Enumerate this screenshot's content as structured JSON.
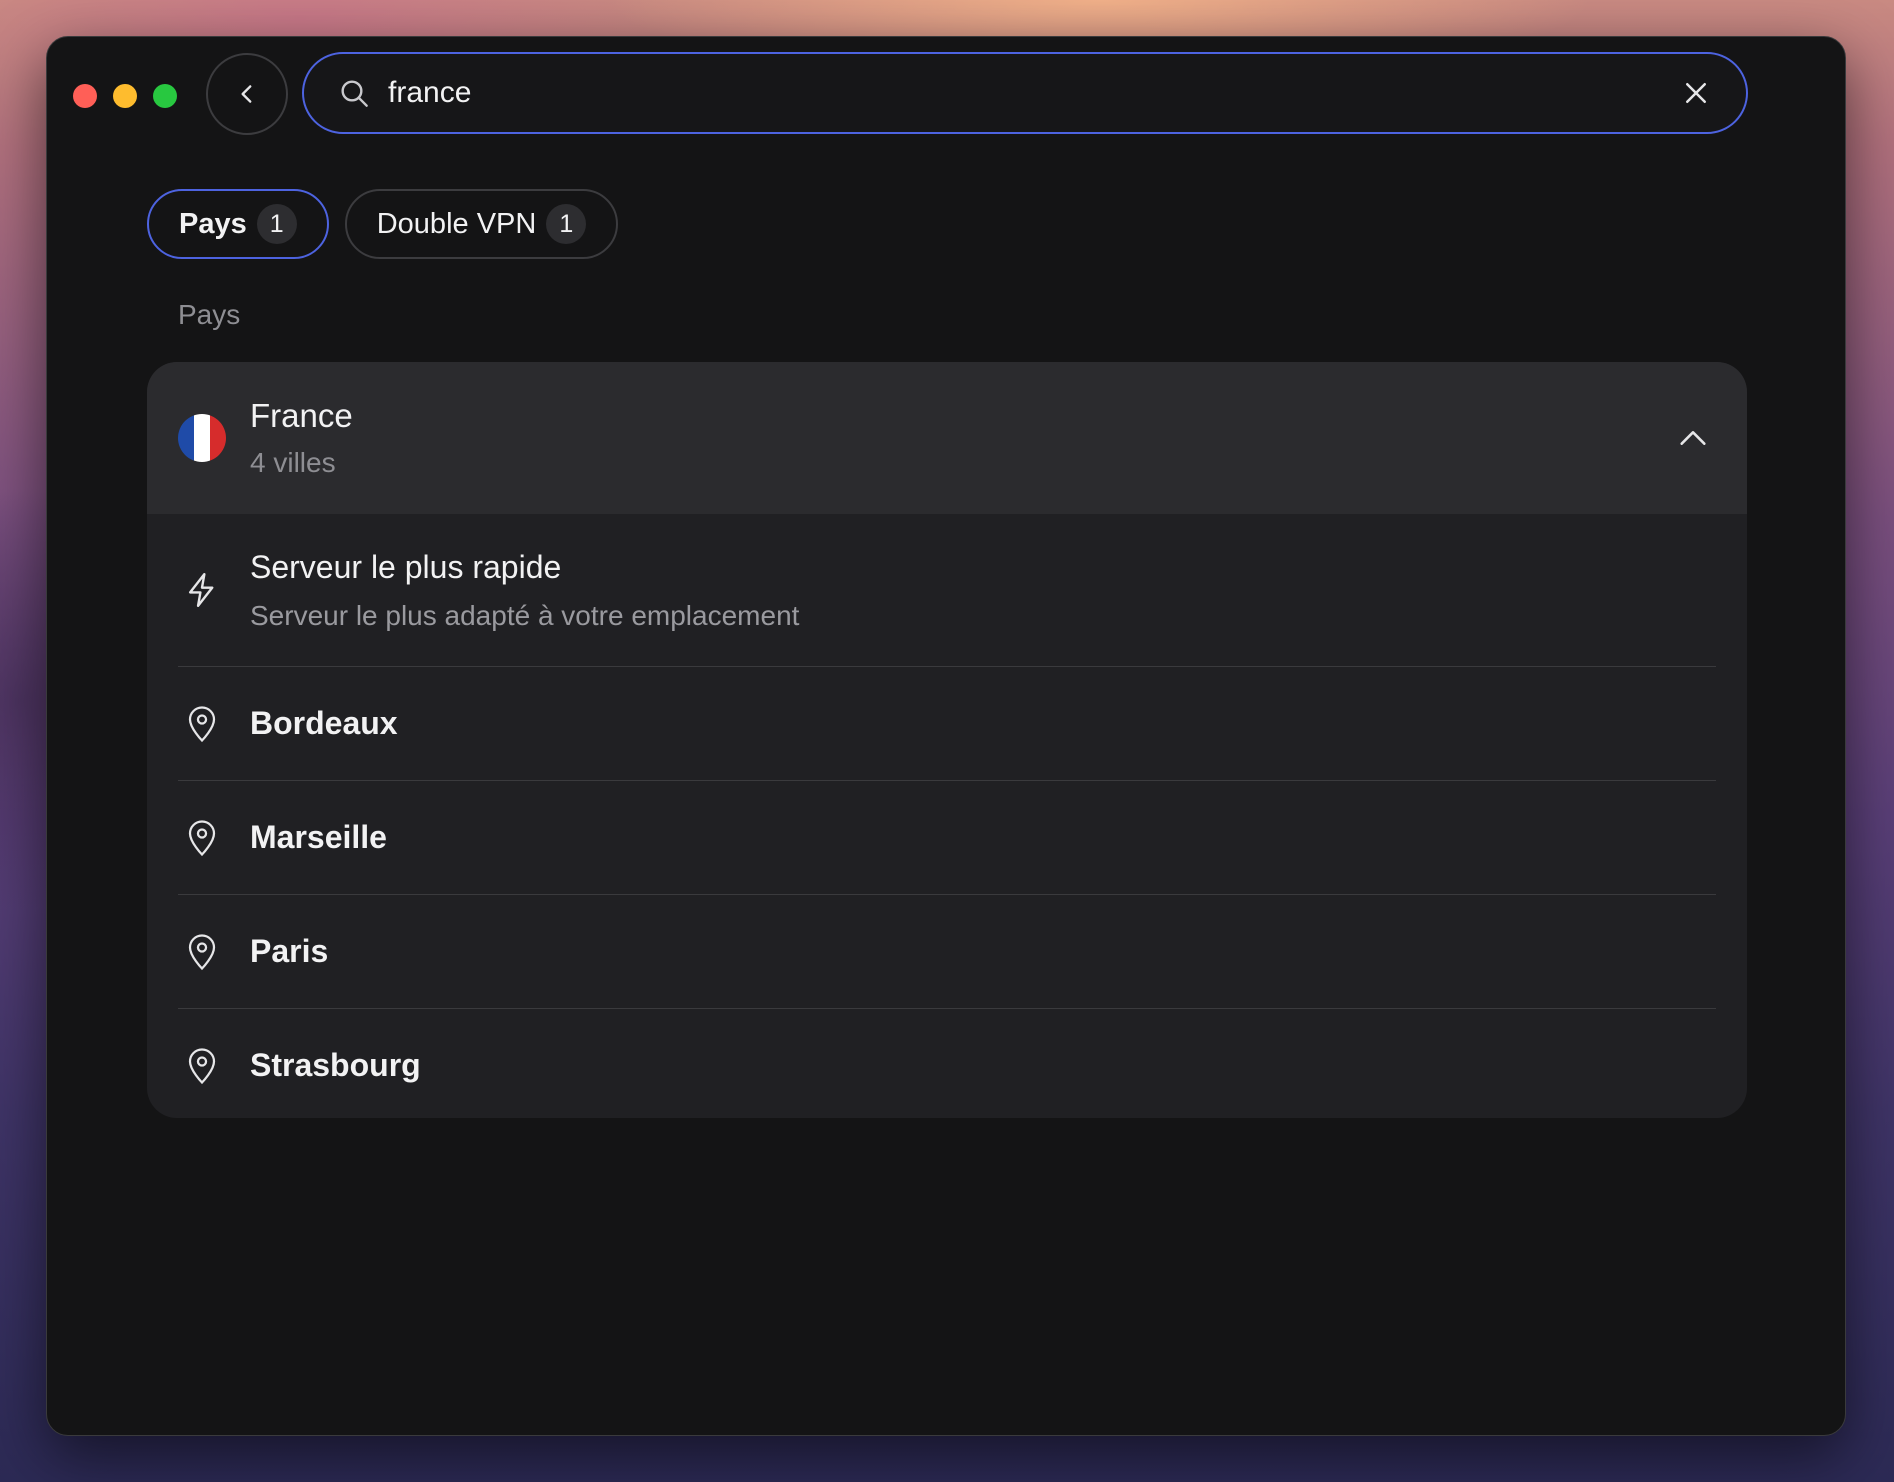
{
  "search": {
    "value": "france"
  },
  "filters": [
    {
      "label": "Pays",
      "count": "1",
      "active": true
    },
    {
      "label": "Double VPN",
      "count": "1",
      "active": false
    }
  ],
  "section": {
    "label": "Pays"
  },
  "country": {
    "name": "France",
    "subtitle": "4 villes",
    "flag_colors": [
      "#1f4ba8",
      "#ffffff",
      "#d62c2c"
    ]
  },
  "fastest": {
    "title": "Serveur le plus rapide",
    "subtitle": "Serveur le plus adapté à votre emplacement"
  },
  "cities": [
    {
      "name": "Bordeaux"
    },
    {
      "name": "Marseille"
    },
    {
      "name": "Paris"
    },
    {
      "name": "Strasbourg"
    }
  ],
  "colors": {
    "accent": "#4d63e0",
    "window_bg": "#141415",
    "card_bg": "#202023"
  }
}
